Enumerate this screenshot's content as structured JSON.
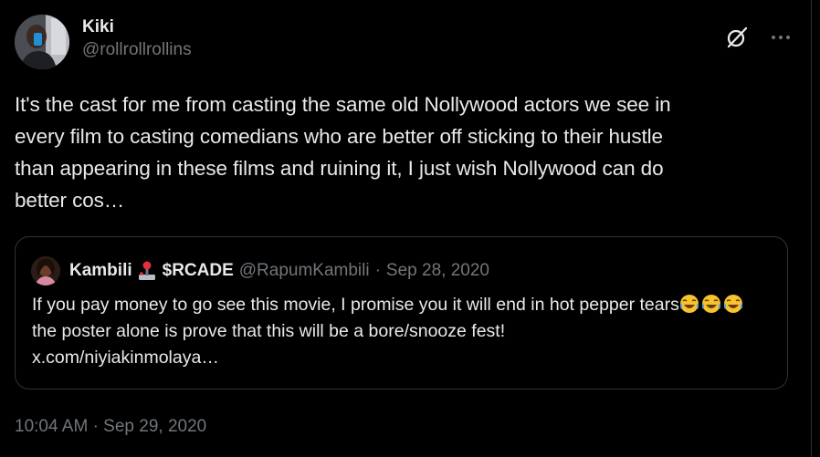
{
  "author": {
    "display_name": "Kiki",
    "handle": "@rollrollrollins"
  },
  "header_actions": {
    "grok_icon": "grok-slash-icon",
    "more_icon": "more-horizontal-icon"
  },
  "tweet": {
    "text": "It's the cast for me from casting the same old Nollywood actors we see in\nevery film to casting comedians who are better off sticking to their hustle\nthan appearing in these films and ruining it, I just wish Nollywood can do\nbetter cos…",
    "time": "10:04 AM",
    "separator": "·",
    "date": "Sep 29, 2020"
  },
  "quoted_tweet": {
    "display_name": "Kambili",
    "name_emoji": "joystick-icon",
    "name_suffix": "$RCADE",
    "handle": "@RapumKambili",
    "separator": "·",
    "date": "Sep 28, 2020",
    "text_part1": "If you pay money to go see this movie, I promise you it will end in hot pepper tears",
    "emoji": "face-with-tears-of-joy-icon",
    "emoji_count": 3,
    "text_part2": " the poster alone is prove that this will be a bore/snooze fest!",
    "link": "x.com/niyiakinmolaya…"
  },
  "colors": {
    "background": "#000000",
    "text_primary": "#e7e9ea",
    "text_secondary": "#71767b",
    "border": "#2f3336"
  }
}
